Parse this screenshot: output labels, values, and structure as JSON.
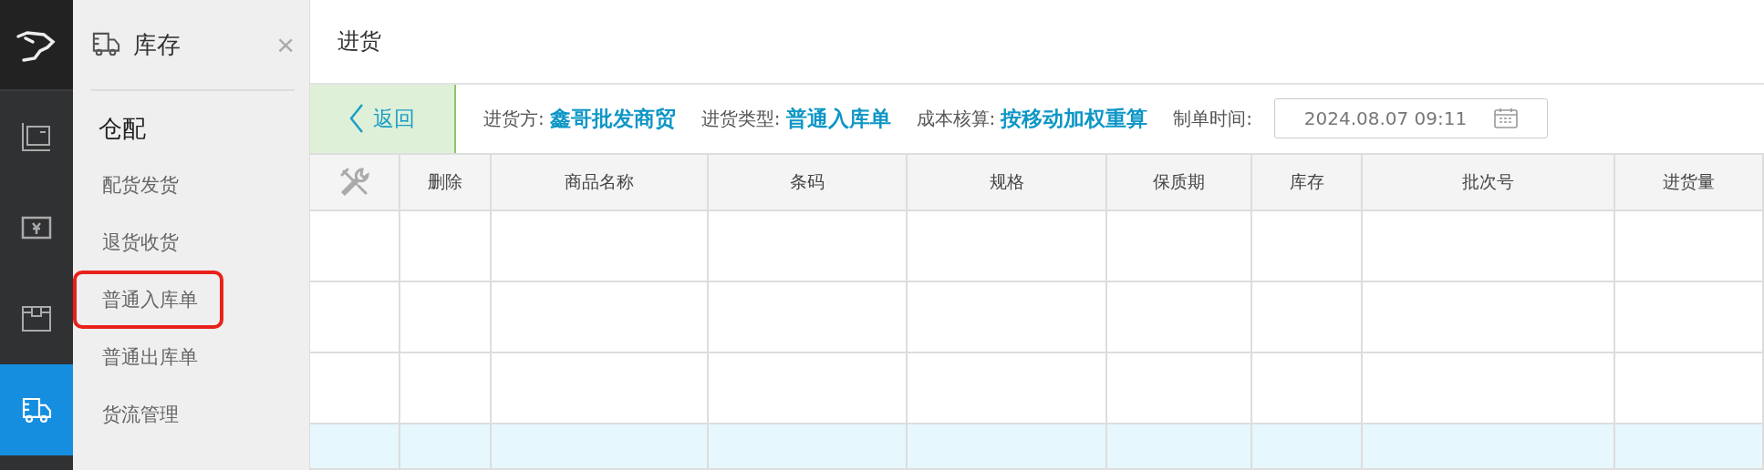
{
  "rail": {
    "items": [
      {
        "selected": false
      },
      {
        "selected": false
      },
      {
        "selected": false
      },
      {
        "selected": true
      }
    ]
  },
  "sidebar": {
    "title": "库存",
    "close": "×",
    "group": "仓配",
    "items": [
      {
        "label": "配货发货",
        "highlighted": false
      },
      {
        "label": "退货收货",
        "highlighted": false
      },
      {
        "label": "普通入库单",
        "highlighted": true
      },
      {
        "label": "普通出库单",
        "highlighted": false
      },
      {
        "label": "货流管理",
        "highlighted": false
      }
    ]
  },
  "page": {
    "title": "进货"
  },
  "toolbar": {
    "back": "返回",
    "fields": [
      {
        "label": "进货方:",
        "value": "鑫哥批发商贸"
      },
      {
        "label": "进货类型:",
        "value": "普通入库单"
      },
      {
        "label": "成本核算:",
        "value": "按移动加权重算"
      }
    ],
    "date_label": "制单时间:",
    "date_value": "2024.08.07 09:11"
  },
  "table": {
    "columns": [
      "删除",
      "商品名称",
      "条码",
      "规格",
      "保质期",
      "库存",
      "批次号",
      "进货量"
    ],
    "rows": [
      {
        "selected": false
      },
      {
        "selected": false
      },
      {
        "selected": false
      },
      {
        "selected": true
      }
    ]
  }
}
